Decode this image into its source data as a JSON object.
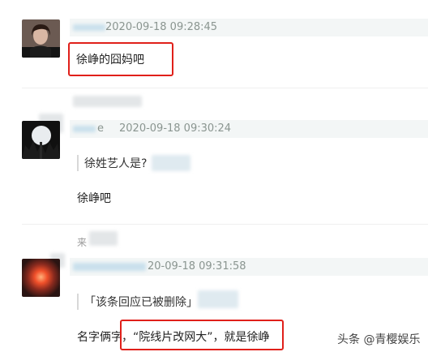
{
  "comments": [
    {
      "timestamp_partial": "2020-09-18 09:28:45",
      "text": "徐峥的囧妈吧"
    },
    {
      "name_partial": "e",
      "timestamp": "2020-09-18 09:30:24",
      "quote": "徐姓艺人是?",
      "text": "徐峥吧"
    },
    {
      "label_partial": "来",
      "timestamp_partial": "20-09-18 09:31:58",
      "quote": "「该条回应已被删除」",
      "text_prefix": "名字俩字",
      "text_highlight": "，“院线片改网大”，就是徐峥"
    }
  ],
  "watermark": "头条 @青樱娱乐",
  "colors": {
    "highlight_border": "#e0201a",
    "meta_text": "#8a9590",
    "header_bg": "#f3f6f6"
  }
}
